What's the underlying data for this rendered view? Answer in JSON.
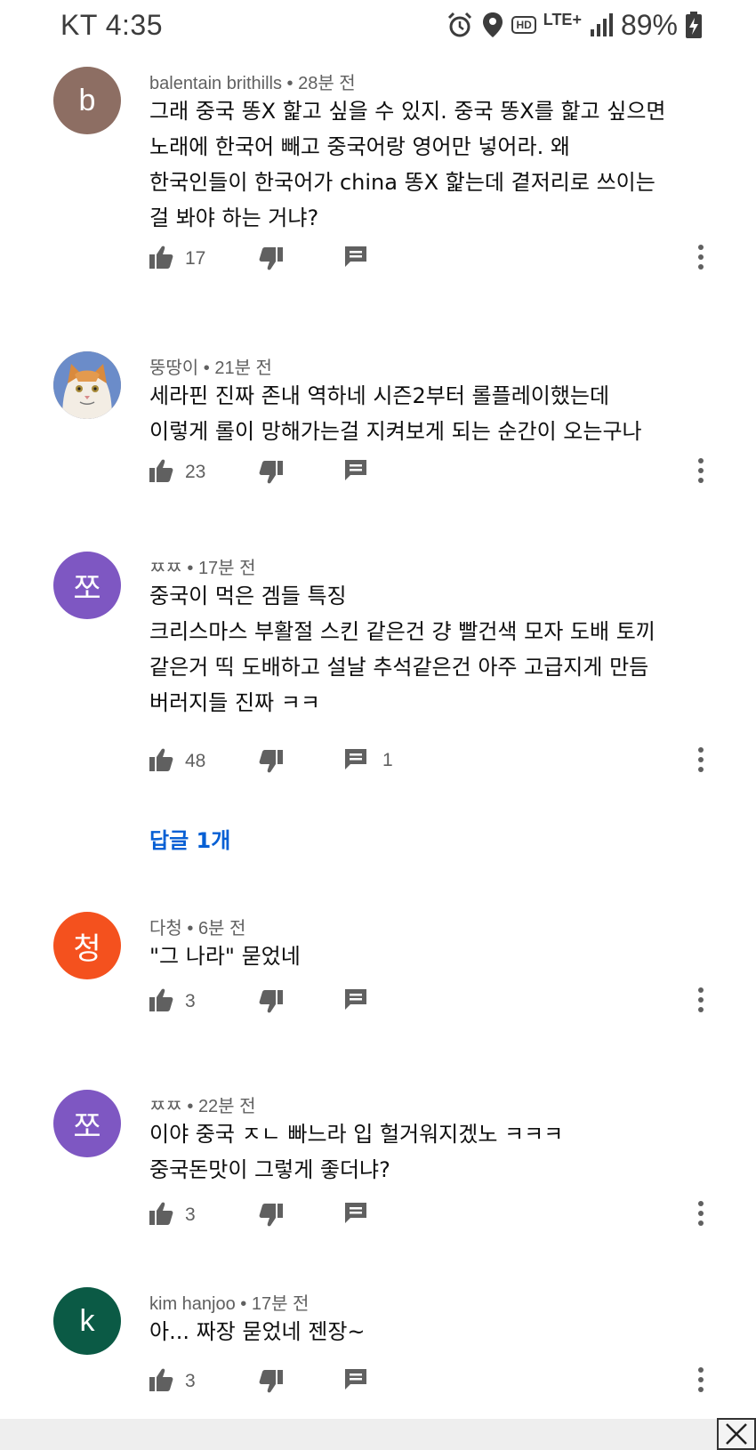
{
  "status_bar": {
    "carrier_time": "KT 4:35",
    "network": "LTE+",
    "hd": "HD",
    "battery": "89%"
  },
  "comments": [
    {
      "avatar_letter": "b",
      "avatar_color": "#8d6e63",
      "author": "balentain brithills",
      "time": "28분 전",
      "text": "그래 중국 똥X 핥고 싶을 수 있지. 중국 똥X를 핥고 싶으면\n노래에 한국어 빼고 중국어랑 영어만 넣어라. 왜\n한국인들이 한국어가 china 똥X 핥는데 곁저리로 쓰이는\n걸 봐야 하는 거냐?",
      "likes": "17",
      "replies": ""
    },
    {
      "avatar_letter": "",
      "avatar_color": "#c9a37a",
      "author": "뚱땅이",
      "time": "21분 전",
      "text": "세라핀 진짜 존내 역하네 시즌2부터 롤플레이했는데\n이렇게 롤이 망해가는걸 지켜보게 되는 순간이 오는구나",
      "likes": "23",
      "replies": ""
    },
    {
      "avatar_letter": "쪼",
      "avatar_color": "#7e57c2",
      "author": "ㅉㅉ",
      "time": "17분 전",
      "text": "중국이 먹은 겜들 특징\n크리스마스 부활절 스킨 같은건 걍 빨건색 모자 도배 토끼\n같은거 띡 도배하고 설날 추석같은건 아주 고급지게 만듬\n버러지들 진짜 ㅋㅋ",
      "likes": "48",
      "replies": "1",
      "replies_link": "답글 1개"
    },
    {
      "avatar_letter": "청",
      "avatar_color": "#f4511e",
      "author": "다청",
      "time": "6분 전",
      "text": "\"그 나라\" 묻었네",
      "likes": "3",
      "replies": ""
    },
    {
      "avatar_letter": "쪼",
      "avatar_color": "#7e57c2",
      "author": "ㅉㅉ",
      "time": "22분 전",
      "text": "이야 중국 ㅈㄴ 빠느라  입 헐거워지겠노 ㅋㅋㅋ\n중국돈맛이 그렇게 좋더냐?",
      "likes": "3",
      "replies": ""
    },
    {
      "avatar_letter": "k",
      "avatar_color": "#0b5a45",
      "author": "kim hanjoo",
      "time": "17분 전",
      "text": "아... 짜장 묻었네 젠장~",
      "likes": "3",
      "replies": ""
    }
  ]
}
